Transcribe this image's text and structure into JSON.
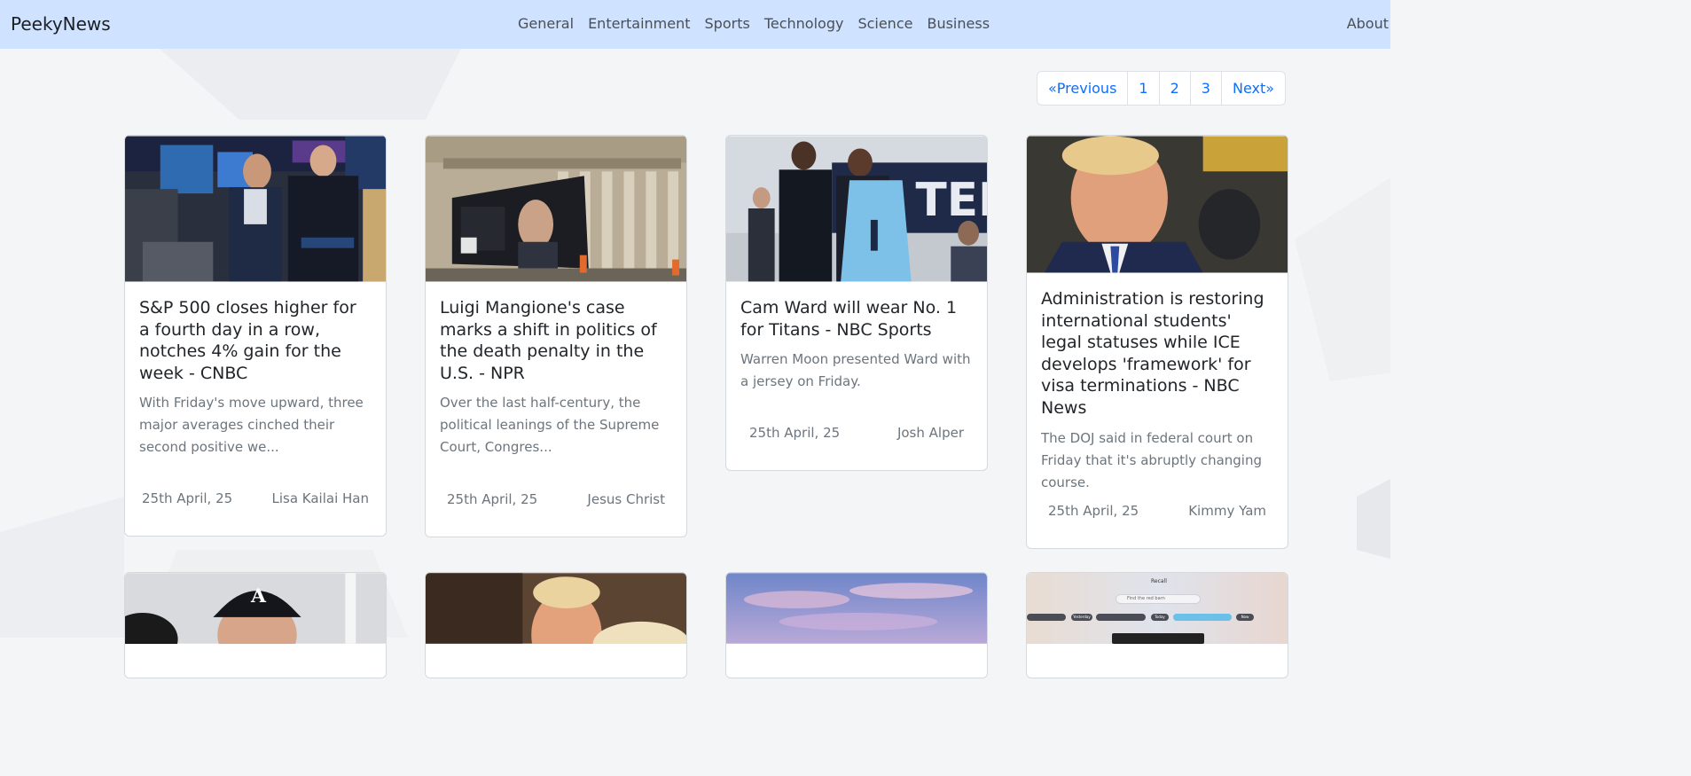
{
  "brand": "PeekyNews",
  "nav": {
    "links": [
      "General",
      "Entertainment",
      "Sports",
      "Technology",
      "Science",
      "Business"
    ],
    "about": "About"
  },
  "pagination": {
    "previous": "«Previous",
    "pages": [
      "1",
      "2",
      "3"
    ],
    "next": "Next»"
  },
  "articles": [
    {
      "title": "S&P 500 closes higher for a fourth day in a row, notches 4% gain for the week - CNBC",
      "description": "With Friday's move upward, three major averages cinched their second positive we...",
      "date": "25th April, 25",
      "author": "Lisa Kailai Han",
      "image": "trading-floor-photo"
    },
    {
      "title": "Luigi Mangione's case marks a shift in politics of the death penalty in the U.S. - NPR",
      "description": "Over the last half-century, the political leanings of the Supreme Court, Congres...",
      "date": "25th April, 25",
      "author": "Jesus Christ",
      "image": "courthouse-truck-photo"
    },
    {
      "title": "Cam Ward will wear No. 1 for Titans - NBC Sports",
      "description": "Warren Moon presented Ward with a jersey on Friday.",
      "date": "25th April, 25",
      "author": "Josh Alper",
      "image": "jersey-presentation-photo"
    },
    {
      "title": "Administration is restoring international students' legal statuses while ICE develops 'framework' for visa terminations - NBC News",
      "description": "The DOJ said in federal court on Friday that it's abruptly changing course.",
      "date": "25th April, 25",
      "author": "Kimmy Yam",
      "image": "portrait-photo"
    }
  ],
  "second_row_images": [
    "baseball-cap-photo",
    "portrait-photo",
    "sky-photo",
    "recall-app-screenshot"
  ],
  "recall_mock": {
    "title": "Recall",
    "search_placeholder": "Find the red barn",
    "chips": [
      "Yesterday",
      "Today",
      "Now"
    ]
  }
}
